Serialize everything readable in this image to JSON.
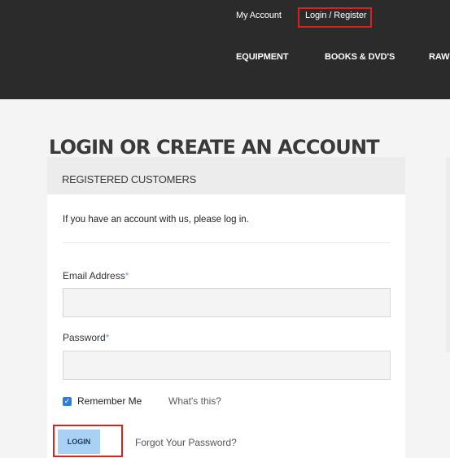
{
  "header": {
    "my_account": "My Account",
    "login_register": "Login / Register",
    "nav": [
      "EQUIPMENT",
      "BOOKS & DVD'S",
      "RAW"
    ]
  },
  "page_title": "LOGIN OR CREATE AN ACCOUNT",
  "registered": {
    "heading": "REGISTERED CUSTOMERS",
    "intro": "If you have an account with us, please log in.",
    "email_label": "Email Address",
    "password_label": "Password",
    "required_mark": "*",
    "email_value": "",
    "password_value": "",
    "remember_label": "Remember Me",
    "remember_checked": true,
    "whats_this": "What's this?",
    "login_button": "LOGIN",
    "forgot": "Forgot Your Password?"
  },
  "colors": {
    "header_bg": "#2b2b2b",
    "highlight_border": "#d42420",
    "button_bg": "#a9d1f4",
    "required": "#5ea7e5"
  }
}
